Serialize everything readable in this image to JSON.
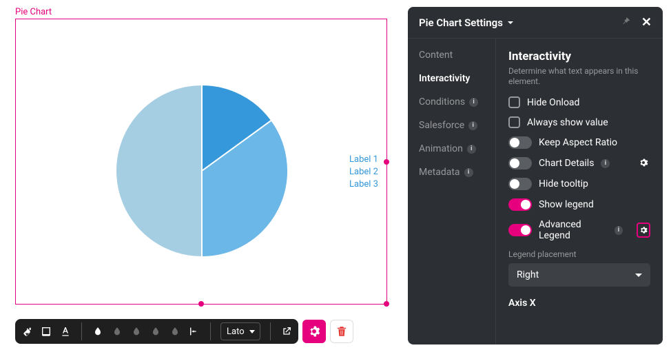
{
  "canvas": {
    "label": "Pie Chart"
  },
  "chart_data": {
    "type": "pie",
    "series": [
      {
        "name": "Label 1",
        "value": 15,
        "color": "#3498db"
      },
      {
        "name": "Label 2",
        "value": 35,
        "color": "#6bb7e8"
      },
      {
        "name": "Label 3",
        "value": 50,
        "color": "#a6cee3"
      }
    ],
    "legend_position": "right"
  },
  "toolbar": {
    "font": "Lato"
  },
  "panel": {
    "title": "Pie Chart Settings",
    "nav": {
      "content": "Content",
      "interactivity": "Interactivity",
      "conditions": "Conditions",
      "salesforce": "Salesforce",
      "animation": "Animation",
      "metadata": "Metadata"
    },
    "section": {
      "heading": "Interactivity",
      "subtext": "Determine what text appears in this element."
    },
    "controls": {
      "hide_onload": "Hide Onload",
      "always_show_value": "Always show value",
      "keep_aspect": "Keep Aspect Ratio",
      "chart_details": "Chart Details",
      "hide_tooltip": "Hide tooltip",
      "show_legend": "Show legend",
      "advanced_legend": "Advanced Legend"
    },
    "legend_placement_label": "Legend placement",
    "legend_placement_value": "Right",
    "axis_x": "Axis X"
  }
}
